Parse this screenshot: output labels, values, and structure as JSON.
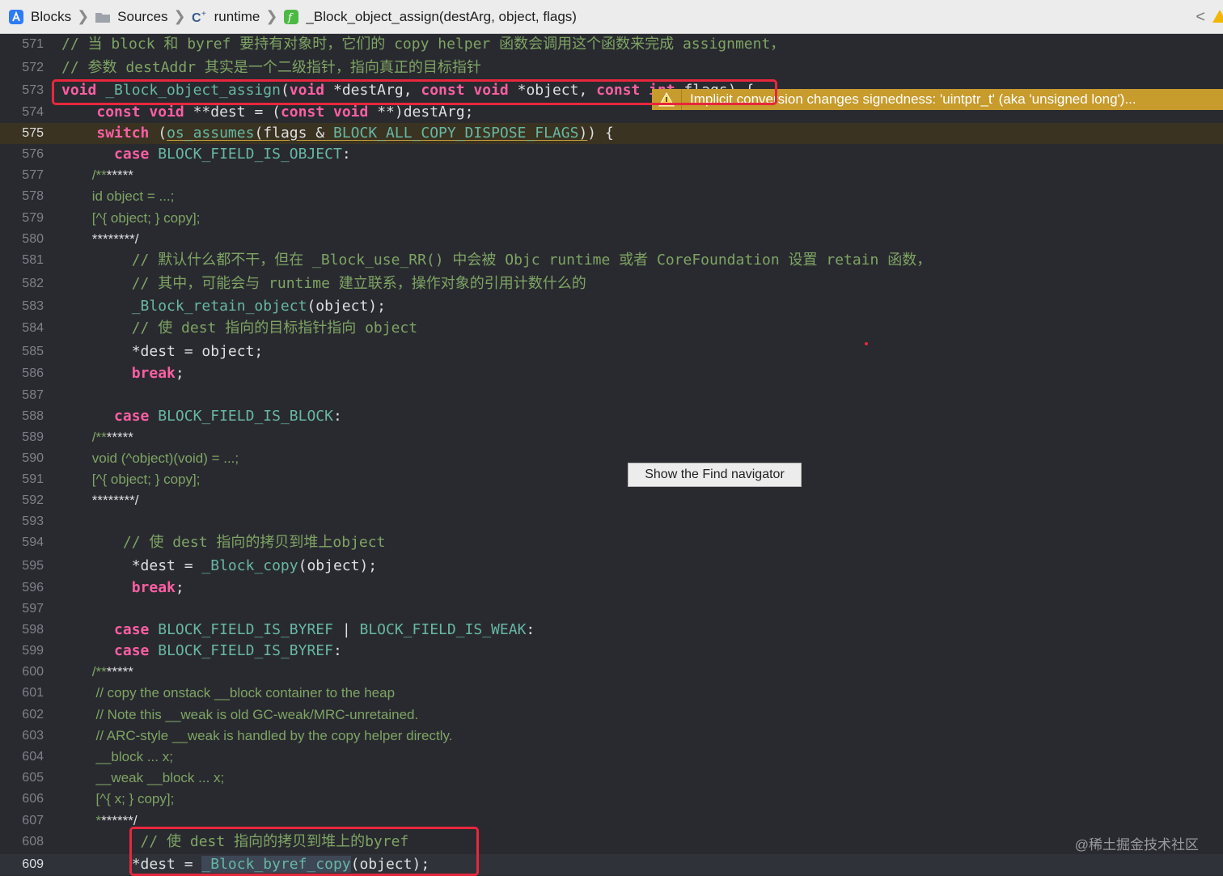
{
  "jumpbar": {
    "crumbs": [
      {
        "label": "Blocks",
        "icon": "project-icon"
      },
      {
        "label": "Sources",
        "icon": "folder-icon"
      },
      {
        "label": "runtime",
        "icon": "c-file-icon"
      },
      {
        "label": "_Block_object_assign(destArg, object, flags)",
        "icon": "function-icon"
      }
    ],
    "back_glyph": "<"
  },
  "warning": {
    "message": "Implicit conversion changes signedness: 'uintptr_t' (aka 'unsigned long')..."
  },
  "tooltip": {
    "text": "Show the Find navigator"
  },
  "watermark": "@稀土掘金技术社区",
  "colors": {
    "keyword": "#fc5fa3",
    "function": "#67b7a4",
    "comment": "#7ea463",
    "plain": "#dfdfe0",
    "highlight_box": "#e8273d",
    "warning": "#c79b2c"
  },
  "lines": [
    {
      "n": "571",
      "tokens": [
        [
          "// 当 block 和 byref 要持有对象时，它们的 copy helper 函数会调用这个函数来完成 assignment，",
          "cmt"
        ]
      ]
    },
    {
      "n": "572",
      "tokens": [
        [
          "// 参数 destAddr 其实是一个二级指针，指向真正的目标指针",
          "cmt"
        ]
      ]
    },
    {
      "n": "573",
      "tokens": [
        [
          "void",
          "kw"
        ],
        [
          " ",
          "plain"
        ],
        [
          "_Block_object_assign",
          "fn"
        ],
        [
          "(",
          "plain"
        ],
        [
          "void",
          "kw"
        ],
        [
          " *destArg, ",
          "plain"
        ],
        [
          "const",
          "kw"
        ],
        [
          " ",
          "plain"
        ],
        [
          "void",
          "kw"
        ],
        [
          " *object, ",
          "plain"
        ],
        [
          "const",
          "kw"
        ],
        [
          " ",
          "plain"
        ],
        [
          "int",
          "kw"
        ],
        [
          " flags) {",
          "plain"
        ]
      ]
    },
    {
      "n": "574",
      "tokens": [
        [
          "    ",
          "plain"
        ],
        [
          "const",
          "kw"
        ],
        [
          " ",
          "plain"
        ],
        [
          "void",
          "kw"
        ],
        [
          " **dest = (",
          "plain"
        ],
        [
          "const",
          "kw"
        ],
        [
          " ",
          "plain"
        ],
        [
          "void",
          "kw"
        ],
        [
          " **)destArg;",
          "plain"
        ]
      ]
    },
    {
      "n": "575",
      "warn": true,
      "tokens": [
        [
          "    ",
          "plain"
        ],
        [
          "switch",
          "kw"
        ],
        [
          " (",
          "plain"
        ],
        [
          "os_assumes",
          "fn ul"
        ],
        [
          "(flags & ",
          "plain ul"
        ],
        [
          "BLOCK_ALL_COPY_DISPOSE_FLAGS",
          "fn ul"
        ],
        [
          ")",
          "plain ul"
        ],
        [
          ") {",
          "plain"
        ]
      ]
    },
    {
      "n": "576",
      "tokens": [
        [
          "      ",
          "plain"
        ],
        [
          "case",
          "kw"
        ],
        [
          " ",
          "plain"
        ],
        [
          "BLOCK_FIELD_IS_OBJECT",
          "fn"
        ],
        [
          ":",
          "plain"
        ]
      ]
    },
    {
      "n": "577",
      "doc": true,
      "tokens": [
        [
          "        /**",
          "cmt"
        ],
        [
          "*****",
          "plain"
        ]
      ]
    },
    {
      "n": "578",
      "doc": true,
      "tokens": [
        [
          "        id object = ...;",
          "cmt"
        ]
      ]
    },
    {
      "n": "579",
      "doc": true,
      "tokens": [
        [
          "        [^{ object; } copy];",
          "cmt"
        ]
      ]
    },
    {
      "n": "580",
      "doc": true,
      "tokens": [
        [
          "        ********/",
          "plain"
        ]
      ]
    },
    {
      "n": "581",
      "tokens": [
        [
          "        // 默认什么都不干，但在 _Block_use_RR() 中会被 Objc runtime 或者 CoreFoundation 设置 retain 函数，",
          "cmt"
        ]
      ]
    },
    {
      "n": "582",
      "tokens": [
        [
          "        // 其中，可能会与 runtime 建立联系，操作对象的引用计数什么的",
          "cmt"
        ]
      ]
    },
    {
      "n": "583",
      "tokens": [
        [
          "        ",
          "plain"
        ],
        [
          "_Block_retain_object",
          "fn"
        ],
        [
          "(object);",
          "plain"
        ]
      ]
    },
    {
      "n": "584",
      "tokens": [
        [
          "        // 使 dest 指向的目标指针指向 object",
          "cmt"
        ]
      ]
    },
    {
      "n": "585",
      "tokens": [
        [
          "        *dest = object;",
          "plain"
        ]
      ]
    },
    {
      "n": "586",
      "tokens": [
        [
          "        ",
          "plain"
        ],
        [
          "break",
          "kw"
        ],
        [
          ";",
          "plain"
        ]
      ]
    },
    {
      "n": "587",
      "tokens": []
    },
    {
      "n": "588",
      "tokens": [
        [
          "      ",
          "plain"
        ],
        [
          "case",
          "kw"
        ],
        [
          " ",
          "plain"
        ],
        [
          "BLOCK_FIELD_IS_BLOCK",
          "fn"
        ],
        [
          ":",
          "plain"
        ]
      ]
    },
    {
      "n": "589",
      "doc": true,
      "tokens": [
        [
          "        /**",
          "cmt"
        ],
        [
          "*****",
          "plain"
        ]
      ]
    },
    {
      "n": "590",
      "doc": true,
      "tokens": [
        [
          "        void (^object)(void) = ...;",
          "cmt"
        ]
      ]
    },
    {
      "n": "591",
      "doc": true,
      "tokens": [
        [
          "        [^{ object; } copy];",
          "cmt"
        ]
      ]
    },
    {
      "n": "592",
      "doc": true,
      "tokens": [
        [
          "        ********/",
          "plain"
        ]
      ]
    },
    {
      "n": "593",
      "tokens": []
    },
    {
      "n": "594",
      "tokens": [
        [
          "       // 使 dest 指向的拷贝到堆上object",
          "cmt"
        ]
      ]
    },
    {
      "n": "595",
      "tokens": [
        [
          "        *dest = ",
          "plain"
        ],
        [
          "_Block_copy",
          "fn"
        ],
        [
          "(object);",
          "plain"
        ]
      ]
    },
    {
      "n": "596",
      "tokens": [
        [
          "        ",
          "plain"
        ],
        [
          "break",
          "kw"
        ],
        [
          ";",
          "plain"
        ]
      ]
    },
    {
      "n": "597",
      "tokens": []
    },
    {
      "n": "598",
      "tokens": [
        [
          "      ",
          "plain"
        ],
        [
          "case",
          "kw"
        ],
        [
          " ",
          "plain"
        ],
        [
          "BLOCK_FIELD_IS_BYREF",
          "fn"
        ],
        [
          " | ",
          "plain"
        ],
        [
          "BLOCK_FIELD_IS_WEAK",
          "fn"
        ],
        [
          ":",
          "plain"
        ]
      ]
    },
    {
      "n": "599",
      "tokens": [
        [
          "      ",
          "plain"
        ],
        [
          "case",
          "kw"
        ],
        [
          " ",
          "plain"
        ],
        [
          "BLOCK_FIELD_IS_BYREF",
          "fn"
        ],
        [
          ":",
          "plain"
        ]
      ]
    },
    {
      "n": "600",
      "doc": true,
      "tokens": [
        [
          "        /**",
          "cmt"
        ],
        [
          "*****",
          "plain"
        ]
      ]
    },
    {
      "n": "601",
      "doc": true,
      "tokens": [
        [
          "         // copy the onstack __block container to the heap",
          "cmt"
        ]
      ]
    },
    {
      "n": "602",
      "doc": true,
      "tokens": [
        [
          "         // Note this __weak is old GC-weak/MRC-unretained.",
          "cmt"
        ]
      ]
    },
    {
      "n": "603",
      "doc": true,
      "tokens": [
        [
          "         // ARC-style __weak is handled by the copy helper directly.",
          "cmt"
        ]
      ]
    },
    {
      "n": "604",
      "doc": true,
      "tokens": [
        [
          "         __block ... x;",
          "cmt"
        ]
      ]
    },
    {
      "n": "605",
      "doc": true,
      "tokens": [
        [
          "         __weak __block ... x;",
          "cmt"
        ]
      ]
    },
    {
      "n": "606",
      "doc": true,
      "tokens": [
        [
          "         [^{ x; } copy];",
          "cmt"
        ]
      ]
    },
    {
      "n": "607",
      "doc": true,
      "tokens": [
        [
          "         *",
          "cmt"
        ],
        [
          "******/",
          "plain"
        ]
      ]
    },
    {
      "n": "608",
      "tokens": [
        [
          "         // 使 dest 指向的拷贝到堆上的byref",
          "cmt"
        ]
      ]
    },
    {
      "n": "609",
      "cur": true,
      "tokens": [
        [
          "        *dest = ",
          "plain"
        ],
        [
          "_Block_byref_copy",
          "fn selbg"
        ],
        [
          "(object);",
          "plain"
        ]
      ]
    }
  ]
}
